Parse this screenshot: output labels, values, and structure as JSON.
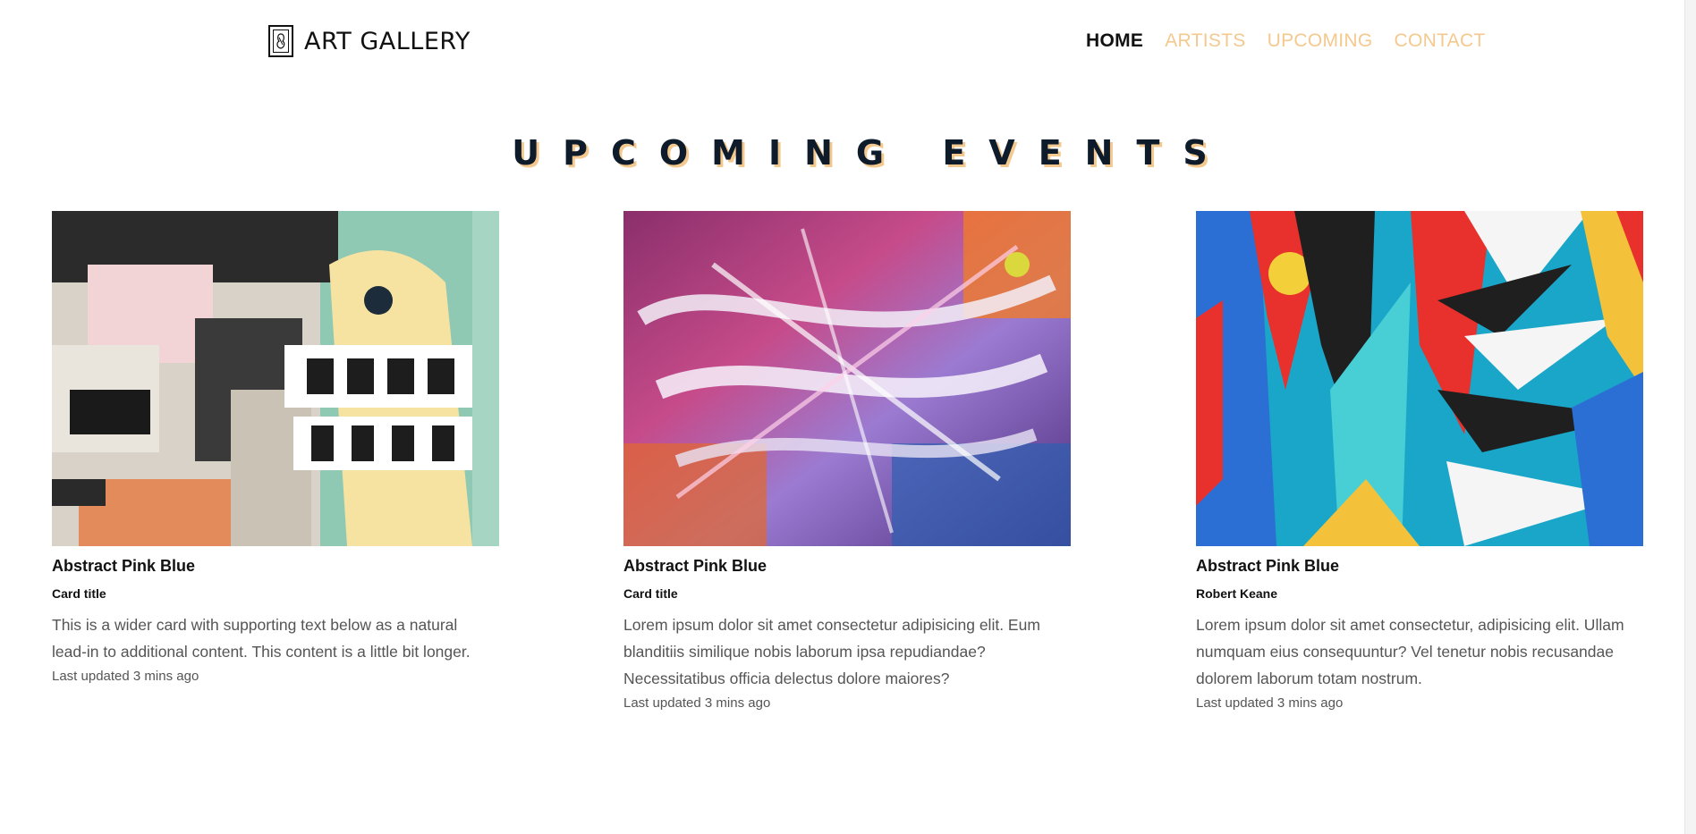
{
  "header": {
    "brand_name": "ART GALLERY",
    "nav": [
      {
        "label": "HOME",
        "active": true
      },
      {
        "label": "ARTISTS",
        "active": false
      },
      {
        "label": "UPCOMING",
        "active": false
      },
      {
        "label": "CONTACT",
        "active": false
      }
    ]
  },
  "section": {
    "title": "UPCOMING EVENTS"
  },
  "cards": [
    {
      "image": "collage-poster-image",
      "heading": "Abstract Pink Blue",
      "subtitle": "Card title",
      "text": "This is a wider card with supporting text below as a natural lead-in to additional content. This content is a little bit longer.",
      "updated": "Last updated 3 mins ago"
    },
    {
      "image": "abstract-paint-image",
      "heading": "Abstract Pink Blue",
      "subtitle": "Card title",
      "text": "Lorem ipsum dolor sit amet consectetur adipisicing elit. Eum blanditiis similique nobis laborum ipsa repudiandae? Necessitatibus officia delectus dolore maiores?",
      "updated": "Last updated 3 mins ago"
    },
    {
      "image": "geometric-mural-image",
      "heading": "Abstract Pink Blue",
      "subtitle": "Robert Keane",
      "text": "Lorem ipsum dolor sit amet consectetur, adipisicing elit. Ullam numquam eius consequuntur? Vel tenetur nobis recusandae dolorem laborum totam nostrum.",
      "updated": "Last updated 3 mins ago"
    }
  ],
  "colors": {
    "accent": "#f4c98f",
    "title": "#0d1b2a",
    "text_muted": "#555555"
  }
}
